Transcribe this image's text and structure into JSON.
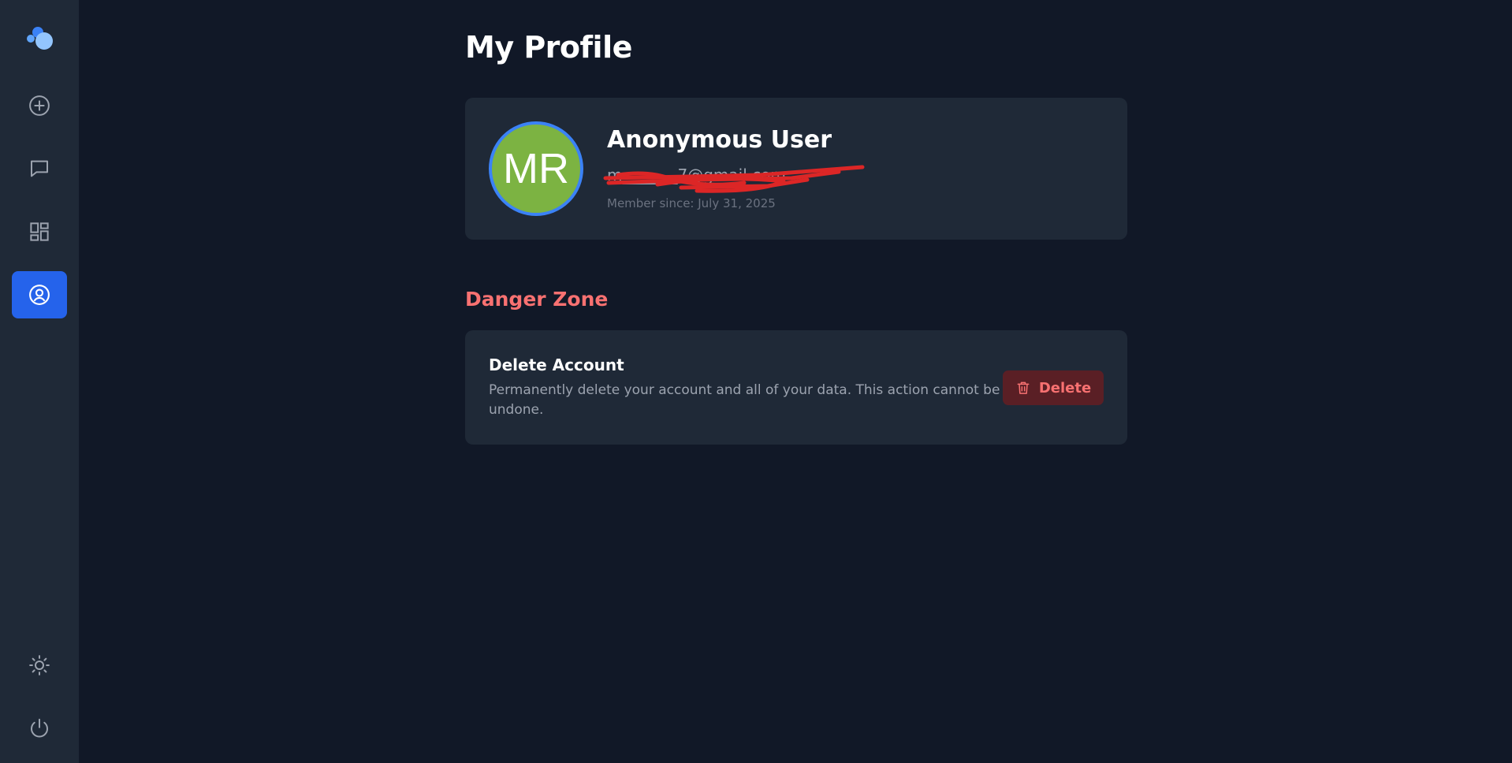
{
  "sidebar": {
    "logo_icon": "bubbles-logo-icon",
    "items": [
      {
        "icon": "plus-circle-icon",
        "label": "New"
      },
      {
        "icon": "chat-bubble-icon",
        "label": "Chats"
      },
      {
        "icon": "dashboard-grid-icon",
        "label": "Dashboard"
      },
      {
        "icon": "user-circle-icon",
        "label": "Profile",
        "active": true
      }
    ],
    "bottom_items": [
      {
        "icon": "sun-icon",
        "label": "Theme"
      },
      {
        "icon": "power-icon",
        "label": "Logout"
      }
    ]
  },
  "profile": {
    "page_title": "My Profile",
    "avatar_initials": "MR",
    "avatar_color": "#7cb342",
    "name": "Anonymous User",
    "email": "m_______7@gmail.com",
    "member_since": "Member since: July 31, 2025"
  },
  "danger_zone": {
    "title": "Danger Zone",
    "delete_title": "Delete Account",
    "delete_description": "Permanently delete your account and all of your data. This action cannot be undone.",
    "delete_button_label": "Delete"
  },
  "colors": {
    "background": "#111827",
    "sidebar": "#1f2937",
    "accent": "#2563eb",
    "danger": "#f87171"
  }
}
